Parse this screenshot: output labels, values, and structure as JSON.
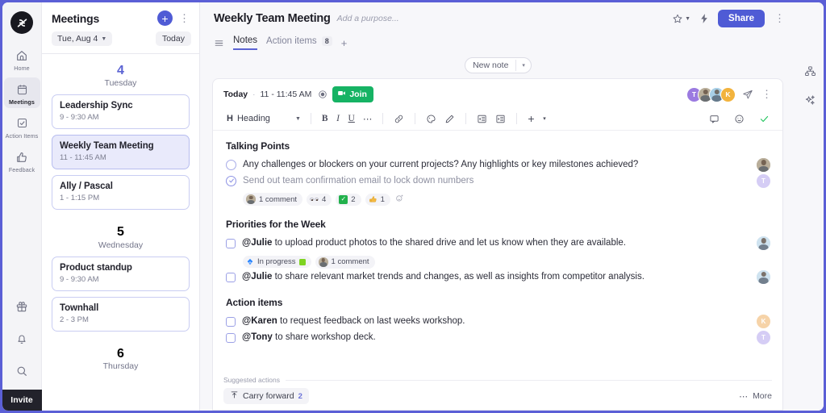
{
  "sidebar": {
    "logo_name": "app-logo",
    "items": [
      {
        "label": "Home",
        "icon": "home-icon",
        "active": false
      },
      {
        "label": "Meetings",
        "icon": "calendar-icon",
        "active": true
      },
      {
        "label": "Action Items",
        "icon": "checkbox-icon",
        "active": false
      },
      {
        "label": "Feedback",
        "icon": "thumbs-up-icon",
        "active": false
      }
    ],
    "bottom_icons": [
      "gift-icon",
      "bell-icon",
      "search-icon"
    ],
    "invite_label": "Invite"
  },
  "meetings_panel": {
    "title": "Meetings",
    "add_label": "+",
    "kebab_label": "⋮",
    "date_selector": "Tue, Aug 4",
    "today_label": "Today",
    "days": [
      {
        "num": "4",
        "name": "Tuesday",
        "highlight": true,
        "meetings": [
          {
            "name": "Leadership Sync",
            "time": "9 - 9:30 AM",
            "selected": false
          },
          {
            "name": "Weekly Team Meeting",
            "time": "11 - 11:45 AM",
            "selected": true
          },
          {
            "name": "Ally / Pascal",
            "time": "1 - 1:15 PM",
            "selected": false
          }
        ]
      },
      {
        "num": "5",
        "name": "Wednesday",
        "highlight": false,
        "meetings": [
          {
            "name": "Product standup",
            "time": "9 - 9:30 AM",
            "selected": false
          },
          {
            "name": "Townhall",
            "time": "2 - 3 PM",
            "selected": false
          }
        ]
      },
      {
        "num": "6",
        "name": "Thursday",
        "highlight": false,
        "meetings": []
      }
    ]
  },
  "header": {
    "title": "Weekly Team Meeting",
    "purpose_placeholder": "Add a purpose...",
    "star_icon": "star-icon",
    "bolt_icon": "lightning-bolt-icon",
    "share_label": "Share",
    "kebab_label": "⋮",
    "menu_icon": "list-view-icon",
    "tabs": [
      {
        "label": "Notes",
        "badge": "",
        "active": true
      },
      {
        "label": "Action items",
        "badge": "8",
        "active": false
      }
    ],
    "tab_add": "+"
  },
  "new_note": {
    "label": "New note",
    "caret": "▾"
  },
  "note": {
    "today_label": "Today",
    "separator": "·",
    "time": "11 - 11:45 AM",
    "record_icon": "record-icon",
    "join_label": "Join",
    "join_icon": "video-camera-icon",
    "send_icon": "send-icon",
    "kebab_label": "⋮",
    "avatars": [
      {
        "initial": "T",
        "color": "#9b7ae0",
        "photo": false
      },
      {
        "initial": "",
        "color": "#b9ae9a",
        "photo": true
      },
      {
        "initial": "",
        "color": "#a8cfe6",
        "photo": true
      },
      {
        "initial": "K",
        "color": "#f2b33d",
        "photo": false
      }
    ],
    "toolbar": {
      "style_label": "Heading",
      "style_prefix": "H",
      "bold": "B",
      "italic": "I",
      "underline": "U",
      "more": "⋯",
      "link_icon": "link-icon",
      "highlight_icon": "palette-icon",
      "pen_icon": "pen-icon",
      "outdent_icon": "outdent-icon",
      "indent_icon": "indent-icon",
      "insert_label": "+",
      "insert_caret": "▾",
      "comment_icon": "comment-icon",
      "emoji_icon": "emoji-icon",
      "check_icon": "check-icon"
    },
    "sections": [
      {
        "title": "Talking Points",
        "items": [
          {
            "checkbox": "circle",
            "checked": false,
            "mention": "",
            "text": "Any challenges or blockers on your current projects? Any highlights or key milestones achieved?",
            "avatar": {
              "initial": "",
              "color": "#b9ae9a",
              "photo": true
            },
            "chips": []
          },
          {
            "checkbox": "circle",
            "checked": true,
            "mention": "",
            "text": "Send out team confirmation email to lock down numbers",
            "avatar": {
              "initial": "T",
              "color": "#d5cdf5",
              "photo": false
            },
            "chips": [
              {
                "type": "comment",
                "label": "1 comment",
                "icon": "avatar-photo"
              },
              {
                "type": "reaction",
                "label": "4",
                "icon": "eyes-emoji"
              },
              {
                "type": "reaction",
                "label": "2",
                "icon": "white-check-mark-emoji"
              },
              {
                "type": "reaction",
                "label": "1",
                "icon": "thumbs-up-emoji"
              },
              {
                "type": "add",
                "label": "",
                "icon": "add-reaction-icon"
              }
            ]
          }
        ]
      },
      {
        "title": "Priorities for the Week",
        "items": [
          {
            "checkbox": "square",
            "checked": false,
            "mention": "@Julie",
            "text": " to upload product photos to the shared drive and let us know when they are available.",
            "avatar": {
              "initial": "",
              "color": "#cfe3f0",
              "photo": true
            },
            "chips": [
              {
                "type": "status",
                "label": "In progress",
                "icon": "jira-icon"
              },
              {
                "type": "comment",
                "label": "1 comment",
                "icon": "avatar-photo"
              }
            ]
          },
          {
            "checkbox": "square",
            "checked": false,
            "mention": "@Julie",
            "text": " to share relevant market trends and changes, as well as insights from competitor analysis.",
            "avatar": {
              "initial": "",
              "color": "#cfe3f0",
              "photo": true
            },
            "chips": []
          }
        ]
      },
      {
        "title": "Action items",
        "items": [
          {
            "checkbox": "square",
            "checked": false,
            "mention": "@Karen",
            "text": " to request feedback on last weeks workshop.",
            "avatar": {
              "initial": "K",
              "color": "#f6d3a8",
              "photo": false
            },
            "chips": []
          },
          {
            "checkbox": "square",
            "checked": false,
            "mention": "@Tony",
            "text": " to share workshop deck.",
            "avatar": {
              "initial": "T",
              "color": "#d5cdf5",
              "photo": false
            },
            "chips": []
          }
        ]
      }
    ]
  },
  "suggested": {
    "label": "Suggested actions",
    "chip_label": "Carry forward",
    "chip_count": "2",
    "chip_icon": "carry-forward-icon",
    "more_label": "More",
    "more_icon": "ellipsis-icon"
  },
  "right_rail": {
    "icons": [
      "org-chart-icon",
      "sparkles-icon"
    ]
  },
  "colors": {
    "accent": "#4f5bd5",
    "green": "#16b364",
    "panel_bg": "#f7f7fa"
  }
}
